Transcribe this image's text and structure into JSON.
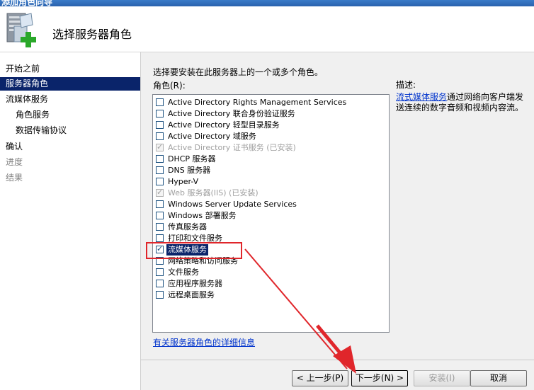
{
  "window": {
    "title": "添加角色向导"
  },
  "header": {
    "title": "选择服务器角色"
  },
  "nav": [
    {
      "label": "开始之前",
      "state": "normal",
      "level": 0
    },
    {
      "label": "服务器角色",
      "state": "active",
      "level": 0
    },
    {
      "label": "流媒体服务",
      "state": "normal",
      "level": 0
    },
    {
      "label": "角色服务",
      "state": "normal",
      "level": 1
    },
    {
      "label": "数据传输协议",
      "state": "normal",
      "level": 1
    },
    {
      "label": "确认",
      "state": "normal",
      "level": 0
    },
    {
      "label": "进度",
      "state": "disabled",
      "level": 0
    },
    {
      "label": "结果",
      "state": "disabled",
      "level": 0
    }
  ],
  "main": {
    "instruction": "选择要安装在此服务器上的一个或多个角色。",
    "roles_label": "角色(R):",
    "roles": [
      {
        "label": "Active Directory Rights Management Services",
        "checked": false,
        "disabled": false
      },
      {
        "label": "Active Directory 联合身份验证服务",
        "checked": false,
        "disabled": false
      },
      {
        "label": "Active Directory 轻型目录服务",
        "checked": false,
        "disabled": false
      },
      {
        "label": "Active Directory 域服务",
        "checked": false,
        "disabled": false
      },
      {
        "label": "Active Directory 证书服务  (已安装)",
        "checked": true,
        "disabled": true
      },
      {
        "label": "DHCP 服务器",
        "checked": false,
        "disabled": false
      },
      {
        "label": "DNS 服务器",
        "checked": false,
        "disabled": false
      },
      {
        "label": "Hyper-V",
        "checked": false,
        "disabled": false
      },
      {
        "label": "Web 服务器(IIS)  (已安装)",
        "checked": true,
        "disabled": true
      },
      {
        "label": "Windows Server Update Services",
        "checked": false,
        "disabled": false
      },
      {
        "label": "Windows 部署服务",
        "checked": false,
        "disabled": false
      },
      {
        "label": "传真服务器",
        "checked": false,
        "disabled": false
      },
      {
        "label": "打印和文件服务",
        "checked": false,
        "disabled": false
      },
      {
        "label": "流媒体服务",
        "checked": true,
        "disabled": false,
        "selected": true
      },
      {
        "label": "网络策略和访问服务",
        "checked": false,
        "disabled": false
      },
      {
        "label": "文件服务",
        "checked": false,
        "disabled": false
      },
      {
        "label": "应用程序服务器",
        "checked": false,
        "disabled": false
      },
      {
        "label": "远程桌面服务",
        "checked": false,
        "disabled": false
      }
    ],
    "more_info_link": "有关服务器角色的详细信息",
    "description_title": "描述:",
    "description_link": "流式媒体服务",
    "description_text": "通过网络向客户端发送连续的数字音频和视频内容流。"
  },
  "buttons": {
    "back": "< 上一步(P)",
    "next": "下一步(N) >",
    "install": "安装(I)",
    "cancel": "取消"
  },
  "colors": {
    "selection": "#0a246a",
    "annotation": "#e0262b",
    "link": "#0033cc"
  }
}
